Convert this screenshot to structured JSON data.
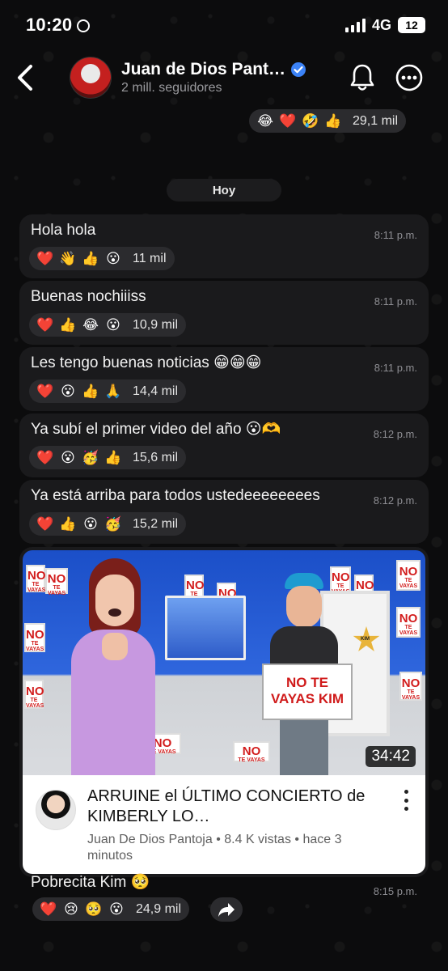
{
  "status": {
    "time": "10:20",
    "network": "4G",
    "battery": "12"
  },
  "header": {
    "channel_name": "Juan de Dios Pant…",
    "subscribers": "2 mill. seguidores"
  },
  "top_reactions": {
    "emojis": [
      "😂",
      "❤️",
      "🤣",
      "👍"
    ],
    "count": "29,1 mil"
  },
  "day_separator": "Hoy",
  "messages": [
    {
      "text": "Hola hola",
      "time": "8:11 p.m.",
      "emojis": [
        "❤️",
        "👋",
        "👍",
        "😮"
      ],
      "count": "11 mil"
    },
    {
      "text": "Buenas nochiiiss",
      "time": "8:11 p.m.",
      "emojis": [
        "❤️",
        "👍",
        "😂",
        "😮"
      ],
      "count": "10,9 mil"
    },
    {
      "text": "Les tengo buenas noticias 😁😁😁",
      "time": "8:11 p.m.",
      "emojis": [
        "❤️",
        "😮",
        "👍",
        "🙏"
      ],
      "count": "14,4 mil"
    },
    {
      "text": "Ya subí el primer video del año 😮🫶",
      "time": "8:12 p.m.",
      "emojis": [
        "❤️",
        "😮",
        "🥳",
        "👍"
      ],
      "count": "15,6 mil"
    },
    {
      "text": "Ya está arriba para todos ustedeeeeeeees",
      "time": "8:12 p.m.",
      "emojis": [
        "❤️",
        "👍",
        "😮",
        "🥳"
      ],
      "count": "15,2 mil"
    }
  ],
  "video": {
    "duration": "34:42",
    "title": "ARRUINE el ÚLTIMO CONCIERTO de KIMBERLY LO…",
    "channel": "Juan De Dios Pantoja",
    "views": "8.4 K vistas",
    "age": "hace 3 minutos",
    "meta": "Juan De Dios Pantoja • 8.4 K vistas • hace 3 minutos",
    "sign_text": "NO TE VAYAS KIM",
    "poster_big": "NO",
    "poster_small": "TE VAYAS",
    "star_label": "KIM"
  },
  "last_message": {
    "text": "Pobrecita Kim 🥺",
    "time": "8:15 p.m.",
    "emojis": [
      "❤️",
      "😢",
      "🥺",
      "😮"
    ],
    "count": "24,9 mil"
  }
}
